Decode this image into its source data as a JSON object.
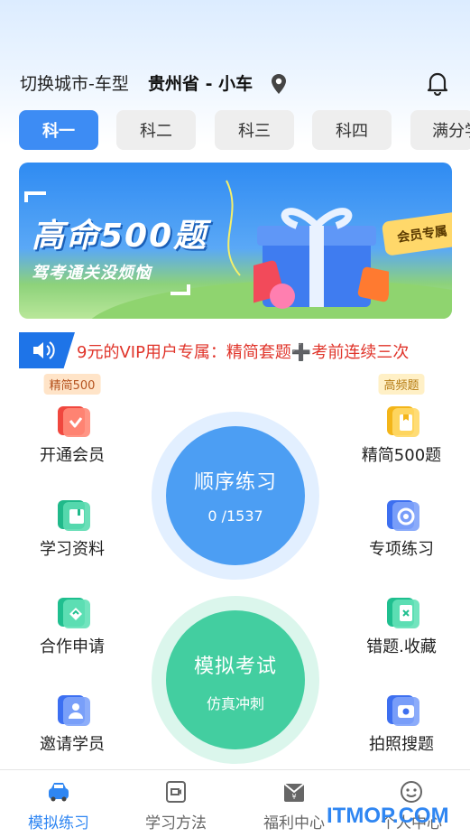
{
  "header": {
    "switch_label": "切换城市-车型",
    "region": "贵州省 - 小车"
  },
  "tabs": [
    "科一",
    "科二",
    "科三",
    "科四",
    "满分学"
  ],
  "banner": {
    "title": "高命500题",
    "subtitle": "驾考通关没烦恼",
    "tag": "会员专属"
  },
  "marquee": {
    "text": "9元的VIP用户专属：精简套题➕考前连续三次"
  },
  "menu": {
    "left": [
      {
        "label": "开通会员",
        "badge": "精简500",
        "icon": "vip-card-icon"
      },
      {
        "label": "学习资料",
        "icon": "book-icon"
      },
      {
        "label": "合作申请",
        "icon": "handshake-icon"
      },
      {
        "label": "邀请学员",
        "icon": "invite-user-icon"
      }
    ],
    "right": [
      {
        "label": "精简500题",
        "badge": "高频题",
        "icon": "bookmark-card-icon"
      },
      {
        "label": "专项练习",
        "icon": "target-icon"
      },
      {
        "label": "错题.收藏",
        "icon": "wrong-question-icon"
      },
      {
        "label": "拍照搜题",
        "icon": "camera-icon"
      }
    ]
  },
  "sequential": {
    "title": "顺序练习",
    "progress": "0 /1537"
  },
  "mock": {
    "title": "模拟考试",
    "subtitle": "仿真冲刺"
  },
  "nav": [
    {
      "label": "模拟练习",
      "icon": "car-icon"
    },
    {
      "label": "学习方法",
      "icon": "video-icon"
    },
    {
      "label": "福利中心",
      "icon": "gift-icon"
    },
    {
      "label": "个人中心",
      "icon": "smile-icon"
    }
  ],
  "watermark": "ITMOP.COM",
  "colors": {
    "accent": "#3d8cf4",
    "mock": "#43cea0",
    "marquee": "#e0342a"
  }
}
